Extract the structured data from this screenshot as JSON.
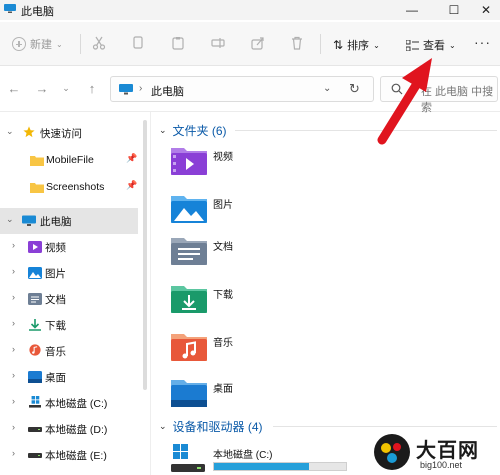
{
  "window": {
    "title": "此电脑"
  },
  "toolbar": {
    "new_label": "新建",
    "sort_label": "排序",
    "view_label": "查看",
    "more_label": "···"
  },
  "address": {
    "crumb": "此电脑",
    "search_placeholder": "在 此电脑 中搜索"
  },
  "nav": {
    "quick_access": "快速访问",
    "pinned": [
      "MobileFile",
      "Screenshots"
    ],
    "this_pc": "此电脑",
    "children": [
      "视频",
      "图片",
      "文档",
      "下载",
      "音乐",
      "桌面",
      "本地磁盘 (C:)",
      "本地磁盘 (D:)",
      "本地磁盘 (E:)"
    ]
  },
  "content": {
    "folders_header": "文件夹 (6)",
    "folders": [
      "视频",
      "图片",
      "文档",
      "下载",
      "音乐",
      "桌面"
    ],
    "drives_header": "设备和驱动器 (4)",
    "drive_c": {
      "name": "本地磁盘 (C:)",
      "used_fraction": 0.72
    }
  },
  "watermark": {
    "brand": "大百网",
    "url": "big100.net"
  },
  "colors": {
    "accent": "#0b5aa8",
    "annotation": "#e0141e",
    "selection": "#e5e5e5"
  }
}
